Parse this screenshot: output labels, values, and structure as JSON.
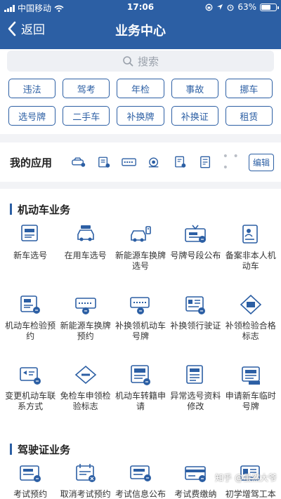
{
  "status_bar": {
    "carrier": "中国移动",
    "time": "17:06",
    "battery": "63%",
    "battery_level": 0.63
  },
  "nav": {
    "back_label": "返回",
    "title": "业务中心"
  },
  "search": {
    "placeholder": "搜索"
  },
  "quick_tags": [
    "违法",
    "驾考",
    "年检",
    "事故",
    "挪车",
    "选号牌",
    "二手车",
    "补换牌",
    "补换证",
    "租赁"
  ],
  "my_apps": {
    "label": "我的应用",
    "icons": [
      "car-icon",
      "document-icon",
      "license-plate-icon",
      "camera-icon",
      "form-icon",
      "card-icon"
    ],
    "more": "• • •",
    "edit_label": "编辑"
  },
  "sections": [
    {
      "title": "机动车业务",
      "items": [
        {
          "label": "新车选号",
          "icon": "license-plate-card-icon"
        },
        {
          "label": "在用车选号",
          "icon": "car-plate-icon"
        },
        {
          "label": "新能源车换牌选号",
          "icon": "new-energy-car-icon"
        },
        {
          "label": "号牌号段公布",
          "icon": "announcement-board-icon"
        },
        {
          "label": "备案非本人机动车",
          "icon": "person-document-icon"
        },
        {
          "label": "机动车检验预约",
          "icon": "inspection-appointment-icon"
        },
        {
          "label": "新能源车换牌预约",
          "icon": "plate-appointment-icon"
        },
        {
          "label": "补换领机动车号牌",
          "icon": "plate-replace-icon"
        },
        {
          "label": "补换领行驶证",
          "icon": "driving-license-replace-icon"
        },
        {
          "label": "补领检验合格标志",
          "icon": "inspection-sticker-icon"
        },
        {
          "label": "变更机动车联系方式",
          "icon": "contact-change-icon"
        },
        {
          "label": "免检车申领检验标志",
          "icon": "exemption-sticker-icon"
        },
        {
          "label": "机动车转籍申请",
          "icon": "transfer-registration-icon"
        },
        {
          "label": "异常选号资料修改",
          "icon": "document-edit-icon"
        },
        {
          "label": "申请新车临时号牌",
          "icon": "temporary-plate-icon"
        }
      ]
    },
    {
      "title": "驾驶证业务",
      "items": [
        {
          "label": "考试预约",
          "icon": "exam-appointment-icon"
        },
        {
          "label": "取消考试预约",
          "icon": "cancel-exam-icon"
        },
        {
          "label": "考试信息公布",
          "icon": "exam-info-icon"
        },
        {
          "label": "考试费缴纳",
          "icon": "exam-fee-icon"
        },
        {
          "label": "初学增驾工本费缴纳",
          "icon": "license-fee-icon"
        }
      ]
    }
  ],
  "watermark": "知乎 @虽然大爷",
  "colors": {
    "brand_blue": "#2c5fa4",
    "background_gray": "#f2f3f6"
  }
}
